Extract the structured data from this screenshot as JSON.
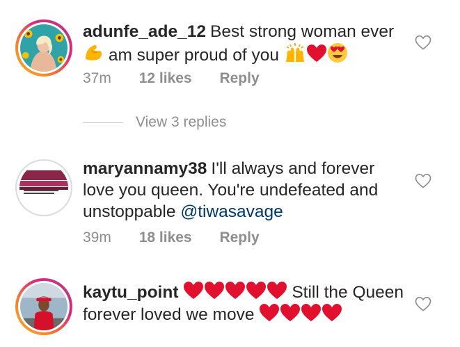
{
  "comments": [
    {
      "username": "adunfe_ade_12",
      "text_1": "Best strong woman ever",
      "text_2": "am super proud of you",
      "time": "37m",
      "likes": "12 likes",
      "reply": "Reply",
      "view_replies": "View 3 replies",
      "emojis": [
        "flexed-biceps-emoji",
        "raising-hands-emoji",
        "red-heart-emoji",
        "heart-eyes-emoji"
      ]
    },
    {
      "username": "maryannamy38",
      "text": "I'll always and forever love you queen. You're undefeated and unstoppable",
      "mention": "@tiwasavage",
      "time": "39m",
      "likes": "18 likes",
      "reply": "Reply"
    },
    {
      "username": "kaytu_point",
      "text": "Still the Queen forever loved we move",
      "emojis": [
        "red-heart-emoji"
      ]
    }
  ],
  "colors": {
    "text": "#262626",
    "secondary": "#8e8e8e",
    "mention": "#00376b",
    "heart": "#e0102e",
    "story_ring_start": "#f9b234",
    "story_ring_end": "#bc1888"
  },
  "icons": {
    "like": "heart-outline-icon"
  }
}
